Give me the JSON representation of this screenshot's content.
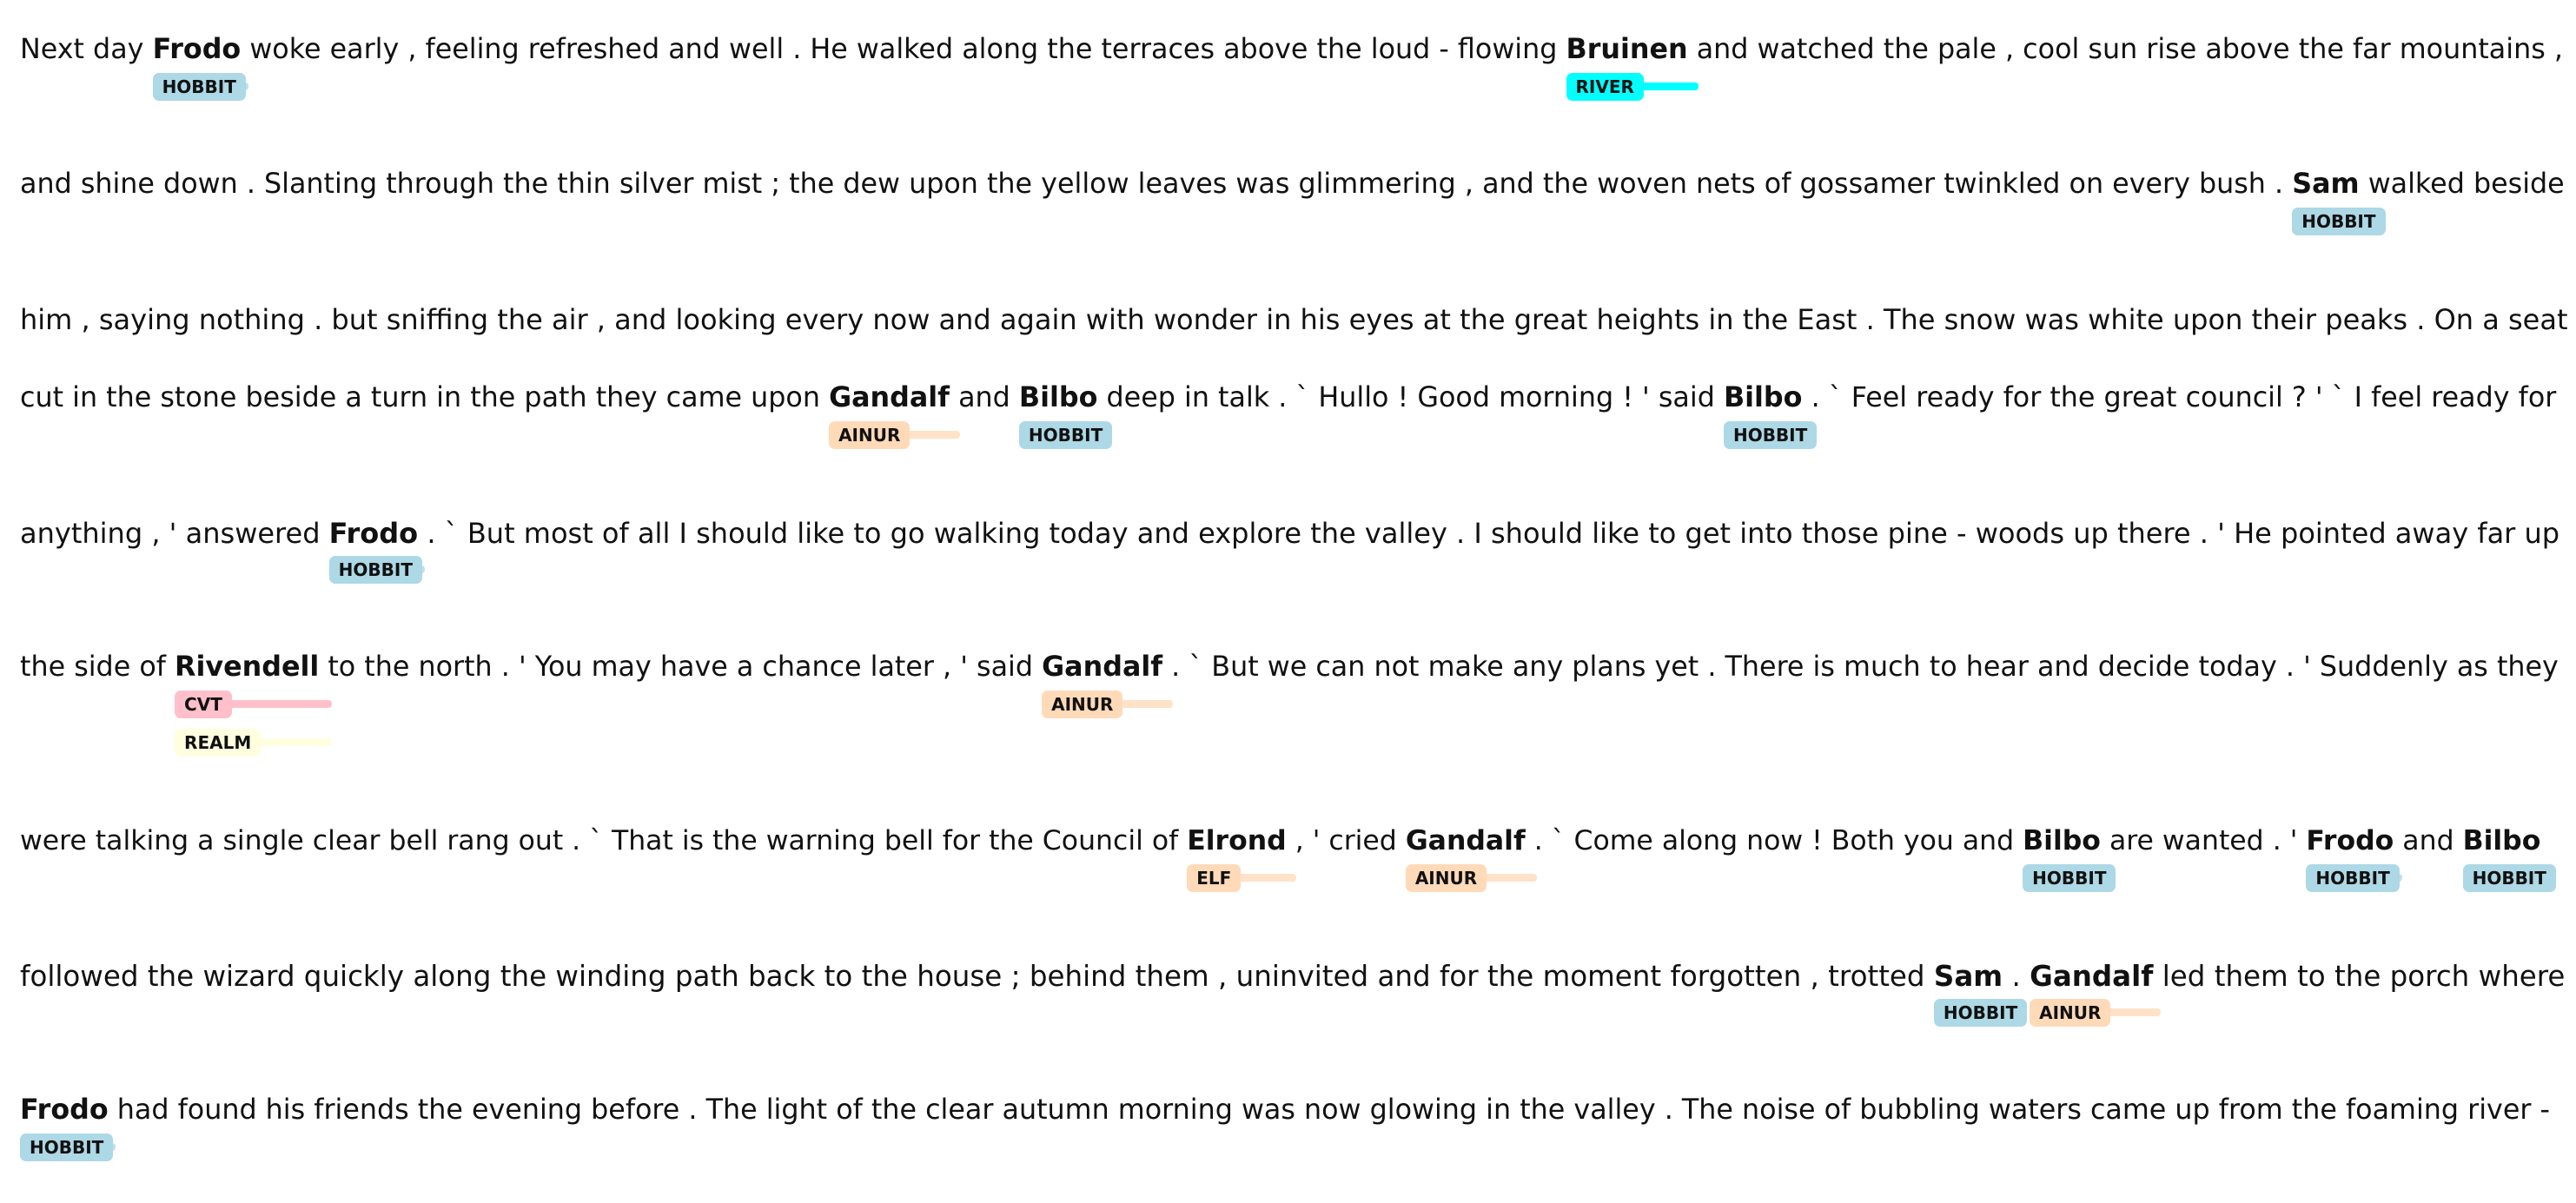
{
  "tag_colors": {
    "HOBBIT": {
      "pill": "#add8e6",
      "bar": "#bfe0eb"
    },
    "RIVER": {
      "pill": "#00ffff",
      "bar": "#00ffff"
    },
    "AINUR": {
      "pill": "#ffdab9",
      "bar": "#ffe2c8"
    },
    "CVT": {
      "pill": "#ffc0cb",
      "bar": "#ffc0cb"
    },
    "REALM": {
      "pill": "#ffffe0",
      "bar": "#ffffe0"
    },
    "ELF": {
      "pill": "#ffdab9",
      "bar": "#ffe2c8"
    }
  },
  "lines": [
    [
      {
        "t": "Next day"
      },
      {
        "t": "Frodo",
        "tags": [
          "HOBBIT"
        ]
      },
      {
        "t": "woke early , feeling refreshed and well . He walked along the terraces above the loud - flowing"
      },
      {
        "t": "Bruinen",
        "tags": [
          "RIVER"
        ]
      },
      {
        "t": "and watched the pale , cool sun rise above the far mountains ,"
      }
    ],
    [
      {
        "t": "and shine down . Slanting through the thin silver mist ; the dew upon the yellow leaves was glimmering , and the woven nets of gossamer twinkled on every bush ."
      },
      {
        "t": "Sam",
        "tags": [
          "HOBBIT"
        ]
      },
      {
        "t": "walked beside"
      }
    ],
    [
      {
        "t": "him , saying nothing . but sniffing the air , and looking every now and again with wonder in his eyes at the great heights in the East . The snow was white upon their peaks . On a seat"
      }
    ],
    [
      {
        "t": "cut in the stone beside a turn in the path they came upon"
      },
      {
        "t": "Gandalf",
        "tags": [
          "AINUR"
        ]
      },
      {
        "t": "and"
      },
      {
        "t": "Bilbo",
        "tags": [
          "HOBBIT"
        ]
      },
      {
        "t": "deep in talk . ` Hullo ! Good morning ! ' said"
      },
      {
        "t": "Bilbo",
        "tags": [
          "HOBBIT"
        ]
      },
      {
        "t": ". ` Feel ready for the great council ? ' ` I feel ready for"
      }
    ],
    [
      {
        "t": "anything , ' answered"
      },
      {
        "t": "Frodo",
        "tags": [
          "HOBBIT"
        ]
      },
      {
        "t": ". ` But most of all I should like to go walking today and explore the valley . I should like to get into those pine - woods up there . ' He pointed away far up"
      }
    ],
    [
      {
        "t": "the side of"
      },
      {
        "t": "Rivendell",
        "tags": [
          "CVT",
          "REALM"
        ]
      },
      {
        "t": "to the north . ' You may have a chance later , ' said"
      },
      {
        "t": "Gandalf",
        "tags": [
          "AINUR"
        ]
      },
      {
        "t": ". ` But we can not make any plans yet . There is much to hear and decide today . ' Suddenly as they"
      }
    ],
    [
      {
        "t": "were talking a single clear bell rang out . ` That is the warning bell for the Council of"
      },
      {
        "t": "Elrond",
        "tags": [
          "ELF"
        ]
      },
      {
        "t": ", ' cried"
      },
      {
        "t": "Gandalf",
        "tags": [
          "AINUR"
        ]
      },
      {
        "t": ". ` Come along now ! Both you and"
      },
      {
        "t": "Bilbo",
        "tags": [
          "HOBBIT"
        ]
      },
      {
        "t": "are wanted . '"
      },
      {
        "t": "Frodo",
        "tags": [
          "HOBBIT"
        ]
      },
      {
        "t": "and"
      },
      {
        "t": "Bilbo",
        "tags": [
          "HOBBIT"
        ]
      }
    ],
    [
      {
        "t": "followed the wizard quickly along the winding path back to the house ; behind them , uninvited and for the moment forgotten , trotted"
      },
      {
        "t": "Sam",
        "tags": [
          "HOBBIT"
        ]
      },
      {
        "t": "."
      },
      {
        "t": "Gandalf",
        "tags": [
          "AINUR"
        ]
      },
      {
        "t": "led them to the porch where"
      }
    ],
    [
      {
        "t": "Frodo",
        "tags": [
          "HOBBIT"
        ]
      },
      {
        "t": "had found his friends the evening before . The light of the clear autumn morning was now glowing in the valley . The noise of bubbling waters came up from the foaming river -"
      }
    ]
  ]
}
